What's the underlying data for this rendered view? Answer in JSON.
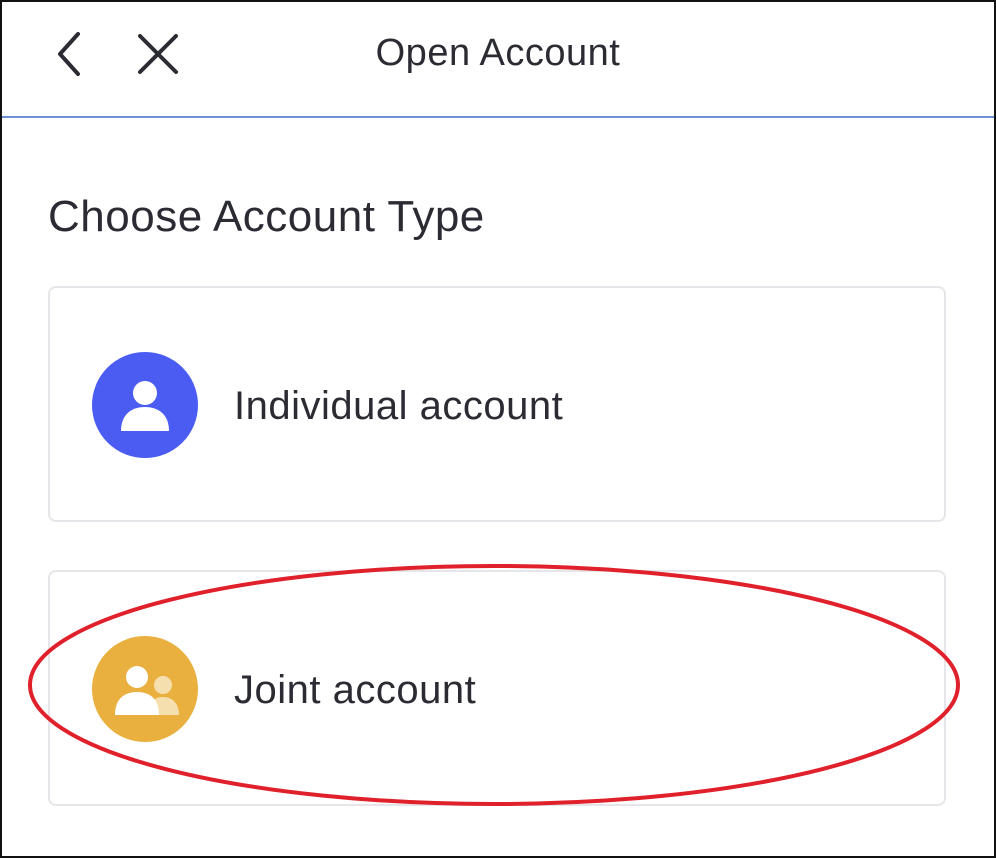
{
  "header": {
    "title": "Open Account",
    "back_icon": "chevron-left-icon",
    "close_icon": "close-icon"
  },
  "main": {
    "heading": "Choose Account Type",
    "options": [
      {
        "label": "Individual account",
        "icon": "user-icon",
        "color": "#4a5cf2"
      },
      {
        "label": "Joint account",
        "icon": "users-icon",
        "color": "#eab03f"
      }
    ]
  },
  "annotation": {
    "shape": "ellipse",
    "color": "#e0202a",
    "target": "Joint account"
  },
  "colors": {
    "divider": "#6f8fd4",
    "text": "#2b2b33",
    "card_border": "#e6e6ea"
  }
}
